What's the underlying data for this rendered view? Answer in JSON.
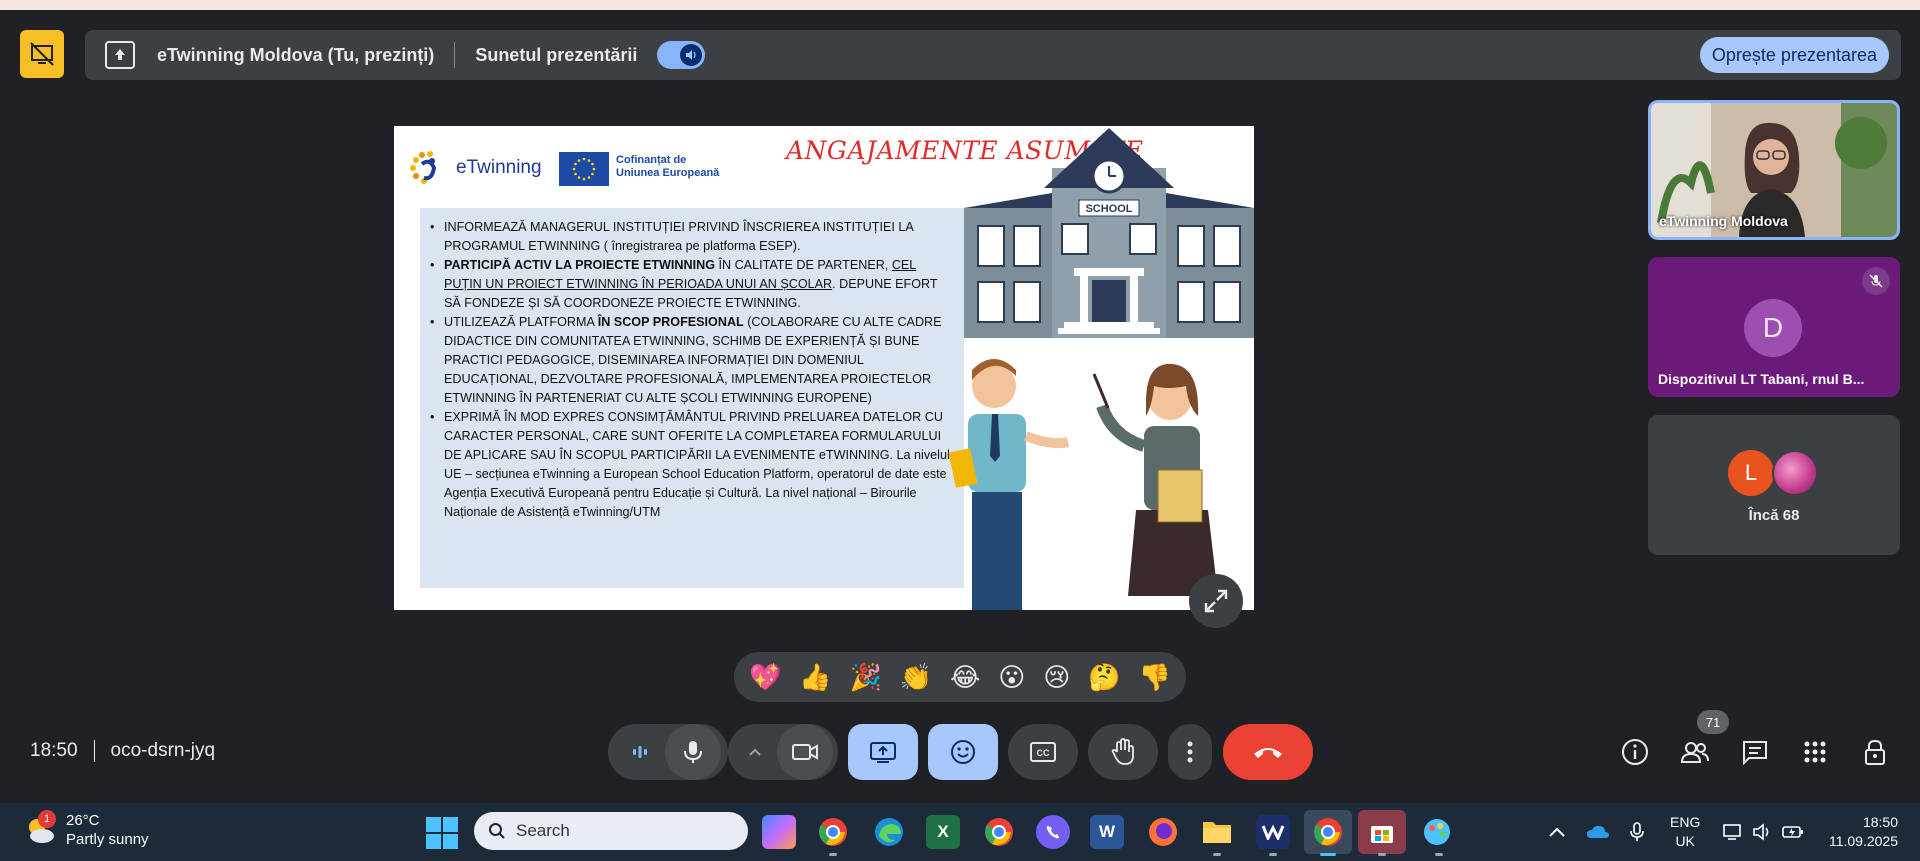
{
  "presenting_bar": {
    "title": "eTwinning Moldova (Tu, prezinți)",
    "sound_label": "Sunetul prezentării",
    "sound_on": true,
    "stop_button": "Oprește prezentarea"
  },
  "slide": {
    "brand": "eTwinning",
    "eu_line1": "Cofinanțat de",
    "eu_line2": "Uniunea Europeană",
    "headline": "ANGAJAMENTE ASUMATE",
    "school_sign": "SCHOOL",
    "bullets": {
      "b1": "INFORMEAZĂ MANAGERUL INSTITUȚIEI PRIVIND ÎNSCRIEREA INSTITUȚIEI LA PROGRAMUL ETWINNING ( înregistrarea pe platforma ESEP).",
      "b2_bold": "PARTICIPĂ ACTIV LA PROIECTE ETWINNING",
      "b2_mid": " ÎN CALITATE DE PARTENER, ",
      "b2_underline": "CEL PUȚIN UN PROIECT ETWINNING ÎN PERIOADA UNUI AN ȘCOLAR",
      "b2_end": ". DEPUNE EFORT SĂ FONDEZE ȘI SĂ COORDONEZE PROIECTE ETWINNING.",
      "b3_start": "UTILIZEAZĂ PLATFORMA ",
      "b3_bold": "ÎN SCOP PROFESIONAL",
      "b3_end": " (COLABORARE CU ALTE CADRE DIDACTICE DIN COMUNITATEA ETWINNING, SCHIMB DE EXPERIENȚĂ ȘI BUNE PRACTICI PEDAGOGICE, DISEMINAREA INFORMAȚIEI DIN DOMENIUL EDUCAȚIONAL, DEZVOLTARE PROFESIONALĂ, IMPLEMENTAREA PROIECTELOR ETWINNING ÎN PARTENERIAT CU ALTE ȘCOLI ETWINNING EUROPENE)",
      "b4": "EXPRIMĂ ÎN MOD EXPRES CONSIMȚĂMÂNTUL PRIVIND PRELUAREA DATELOR CU CARACTER PERSONAL, CARE SUNT OFERITE LA COMPLETAREA FORMULARULUI DE APLICARE SAU ÎN SCOPUL PARTICIPĂRII LA EVENIMENTE eTWINNING. La nivelul UE – secțiunea eTwinning a European School Education Platform,  operatorul de date este Agenția Executivă Europeană pentru Educație și Cultură. La nivel național – Birourile Naționale de Asistență eTwinning/UTM"
    }
  },
  "participants": {
    "tile1_name": "eTwinning Moldova",
    "tile2_initial": "D",
    "tile2_name": "Dispozitivul LT Tabani, rnul B...",
    "tile3_initial": "L",
    "tile3_more": "Încă 68"
  },
  "reactions": [
    "💖",
    "👍",
    "🎉",
    "👏",
    "😂",
    "😮",
    "😢",
    "🤔",
    "👎"
  ],
  "call": {
    "time": "18:50",
    "meeting_code": "oco-dsrn-jyq",
    "people_count": "71"
  },
  "taskbar": {
    "weather_badge": "1",
    "temperature": "26°C",
    "condition": "Partly sunny",
    "search_placeholder": "Search",
    "lang_line1": "ENG",
    "lang_line2": "UK",
    "clock_time": "18:50",
    "clock_date": "11.09.2025"
  },
  "colors": {
    "accent": "#a8c7fa",
    "end_call": "#ea4335",
    "presenting_flag": "#f6bf26",
    "headline": "#e22a2a"
  }
}
